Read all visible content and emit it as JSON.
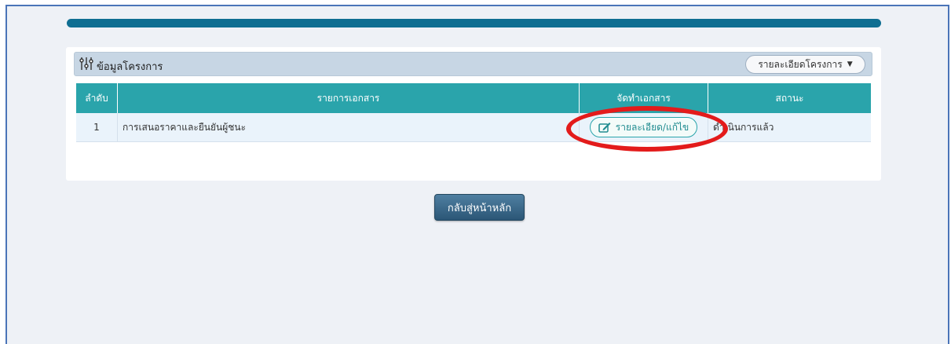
{
  "panel": {
    "title": "ข้อมูลโครงการ",
    "dropdown_label": "รายละเอียดโครงการ",
    "icon": "sliders-icon"
  },
  "table": {
    "headers": [
      "ลำดับ",
      "รายการเอกสาร",
      "จัดทำเอกสาร",
      "สถานะ"
    ],
    "rows": [
      {
        "index": "1",
        "document": "การเสนอราคาและยืนยันผู้ชนะ",
        "action_label": "รายละเอียด/แก้ไข",
        "status": "ดำเนินการแล้ว"
      }
    ]
  },
  "back_button_label": "กลับสู่หน้าหลัก",
  "colors": {
    "accent": "#2aa4ab",
    "top_bar": "#0f6e92",
    "highlight": "#e31b1b"
  }
}
